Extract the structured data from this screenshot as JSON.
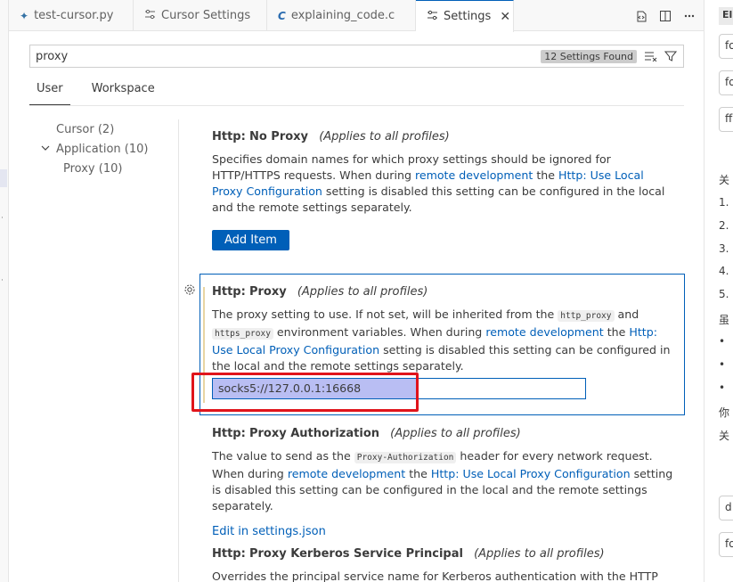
{
  "tabs": [
    {
      "label": "test-cursor.py",
      "icon": "python-icon",
      "icon_glyph": "✦",
      "icon_color": "#3572a5",
      "active": false
    },
    {
      "label": "Cursor Settings",
      "icon": "settings-sliders-icon",
      "icon_glyph": "☰",
      "icon_color": "#616161",
      "active": false
    },
    {
      "label": "explaining_code.c",
      "icon": "c-file-icon",
      "icon_glyph": "C",
      "icon_color": "#2b6cb0",
      "active": false
    },
    {
      "label": "Settings",
      "icon": "settings-sliders-icon",
      "icon_glyph": "☰",
      "icon_color": "#616161",
      "active": true
    }
  ],
  "search": {
    "value": "proxy",
    "results_badge": "12 Settings Found"
  },
  "scope_tabs": [
    "User",
    "Workspace"
  ],
  "toc": [
    {
      "label": "Cursor (2)",
      "indent": 1,
      "twisty": ""
    },
    {
      "label": "Application (10)",
      "indent": 0,
      "twisty": "⌄"
    },
    {
      "label": "Proxy (10)",
      "indent": 2,
      "twisty": ""
    }
  ],
  "settings": {
    "no_proxy": {
      "category": "Http:",
      "name": "No Proxy",
      "scope": "(Applies to all profiles)",
      "desc_1": "Specifies domain names for which proxy settings should be ignored for HTTP/HTTPS requests. When during ",
      "link_1": "remote development",
      "desc_2": " the ",
      "link_2": "Http: Use Local Proxy Configuration",
      "desc_3": " setting is disabled this setting can be configured in the local and the remote settings separately.",
      "button": "Add Item"
    },
    "proxy": {
      "category": "Http:",
      "name": "Proxy",
      "scope": "(Applies to all profiles)",
      "desc_1": "The proxy setting to use. If not set, will be inherited from the ",
      "code_1": "http_proxy",
      "desc_2": " and ",
      "code_2": "https_proxy",
      "desc_3": " environment variables. When during ",
      "link_1": "remote development",
      "desc_4": " the ",
      "link_2": "Http: Use Local Proxy Configuration",
      "desc_5": " setting is disabled this setting can be configured in the local and the remote settings separately.",
      "value": "socks5://127.0.0.1:16668"
    },
    "proxy_authorization": {
      "category": "Http:",
      "name": "Proxy Authorization",
      "scope": "(Applies to all profiles)",
      "desc_1": "The value to send as the ",
      "code_1": "Proxy-Authorization",
      "desc_2": " header for every network request. When during ",
      "link_1": "remote development",
      "desc_3": " the ",
      "link_2": "Http: Use Local Proxy Configuration",
      "desc_4": " setting is disabled this setting can be configured in the local and the remote settings separately.",
      "edit_link": "Edit in settings.json"
    },
    "kerberos": {
      "category": "Http:",
      "name": "Proxy Kerberos Service Principal",
      "scope": "(Applies to all profiles)",
      "desc_1": "Overrides the principal service name for Kerberos authentication with the HTTP proxy."
    }
  },
  "right_panel": {
    "header": "El",
    "boxes": [
      "fo",
      "fo",
      "ff",
      "d",
      "fo"
    ],
    "lines": [
      "关",
      "1.",
      "2.",
      "3.",
      "4.",
      "5.",
      "虽",
      "•",
      "•",
      "•",
      "你",
      "关"
    ]
  },
  "colors": {
    "accent": "#005fb8",
    "highlight_border": "#e0141b",
    "selection": "#b9bef3"
  }
}
